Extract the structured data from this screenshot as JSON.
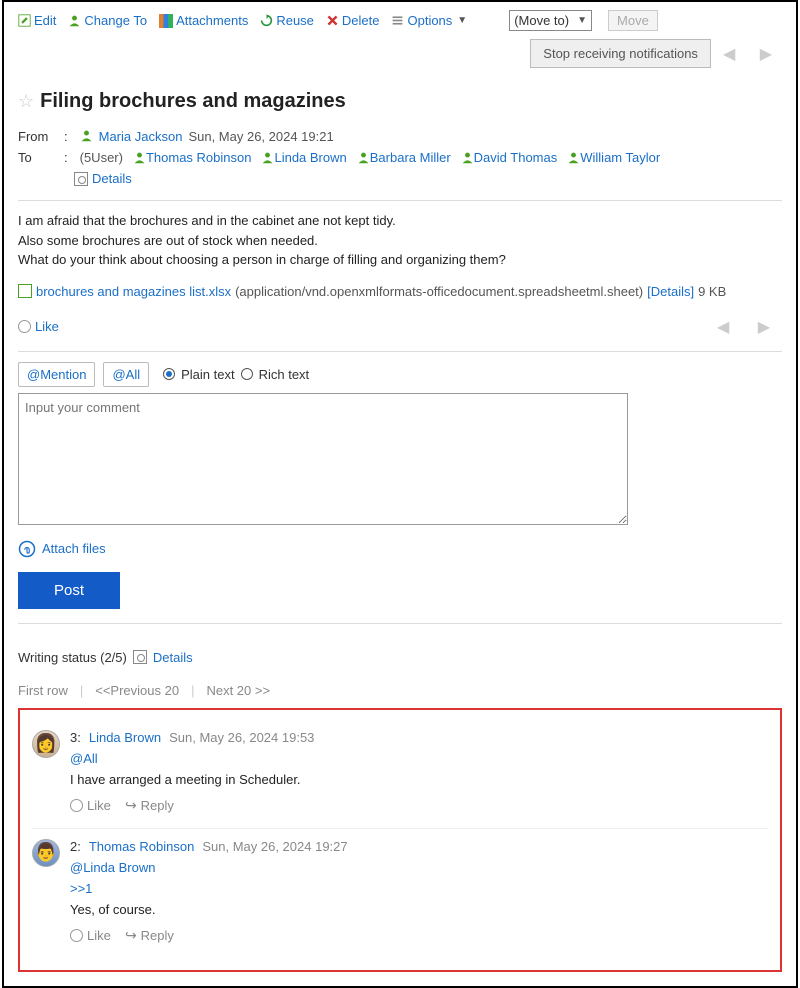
{
  "toolbar": {
    "edit": "Edit",
    "change_to": "Change To",
    "attachments": "Attachments",
    "reuse": "Reuse",
    "delete": "Delete",
    "options": "Options",
    "move_select": "(Move to)",
    "move_btn": "Move",
    "stop_notifications": "Stop receiving notifications"
  },
  "title": "Filing brochures and magazines",
  "meta": {
    "from_label": "From",
    "from_user": "Maria Jackson",
    "from_date": "Sun, May 26, 2024 19:21",
    "to_label": "To",
    "to_count": "(5User)",
    "to_users": [
      "Thomas Robinson",
      "Linda Brown",
      "Barbara Miller",
      "David Thomas",
      "William Taylor"
    ],
    "details": "Details"
  },
  "body": {
    "line1": "I am afraid that the brochures and in the cabinet ane not kept tidy.",
    "line2": "Also some brochures are out of stock when needed.",
    "line3": "What do your think about choosing a person in charge of filling and organizing them?"
  },
  "attachment": {
    "name": "brochures and magazines list.xlsx",
    "mime": "(application/vnd.openxmlformats-officedocument.spreadsheetml.sheet)",
    "details": "[Details]",
    "size": "9 KB"
  },
  "like_label": "Like",
  "comment_form": {
    "mention": "@Mention",
    "all": "@All",
    "plain": "Plain text",
    "rich": "Rich text",
    "placeholder": "Input your comment",
    "attach": "Attach files",
    "post": "Post"
  },
  "writing_status": {
    "label": "Writing status (2/5)",
    "details": "Details"
  },
  "paging": {
    "first": "First row",
    "prev": "<<Previous 20",
    "next": "Next 20 >>"
  },
  "comments": [
    {
      "num": "3:",
      "author": "Linda Brown",
      "date": "Sun, May 26, 2024 19:53",
      "mention": "@All",
      "ref": "",
      "text": "I have arranged a meeting in Scheduler.",
      "like": "Like",
      "reply": "Reply"
    },
    {
      "num": "2:",
      "author": "Thomas Robinson",
      "date": "Sun, May 26, 2024 19:27",
      "mention": "@Linda Brown",
      "ref": ">>1",
      "text": "Yes, of course.",
      "like": "Like",
      "reply": "Reply"
    }
  ]
}
